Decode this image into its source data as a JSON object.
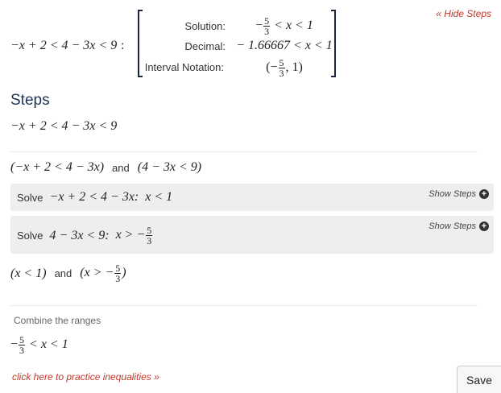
{
  "hide_steps_label": "« Hide Steps",
  "inequality": "−x + 2 < 4 − 3x < 9",
  "colon": ":",
  "result": {
    "solution_label": "Solution:",
    "solution_prefix": "−",
    "solution_num": "5",
    "solution_den": "3",
    "solution_suffix": "< x < 1",
    "decimal_label": "Decimal:",
    "decimal_value": "− 1.66667 < x < 1",
    "interval_label": "Interval Notation:",
    "interval_open": "(−",
    "interval_num": "5",
    "interval_den": "3",
    "interval_close": ", 1)"
  },
  "steps_title": "Steps",
  "steps_expr": "−x + 2 < 4 − 3x < 9",
  "split": {
    "left": "(−x + 2 < 4 − 3x)",
    "and": "and",
    "right": "(4 − 3x < 9)"
  },
  "solve1": {
    "word": "Solve",
    "expr": "−x + 2 < 4 − 3x:",
    "result": "x < 1",
    "show_steps": "Show Steps"
  },
  "solve2": {
    "word": "Solve",
    "expr": "4 − 3x < 9:",
    "result_prefix": "x > −",
    "num": "5",
    "den": "3",
    "show_steps": "Show Steps"
  },
  "combined": {
    "left": "(x < 1)",
    "and": "and",
    "right_open": "(x > −",
    "num": "5",
    "den": "3",
    "right_close": ")"
  },
  "combine_label": "Combine the ranges",
  "final": {
    "prefix": "−",
    "num": "5",
    "den": "3",
    "suffix": "< x < 1"
  },
  "practice_link": "click here to practice inequalities »",
  "save_label": "Save"
}
